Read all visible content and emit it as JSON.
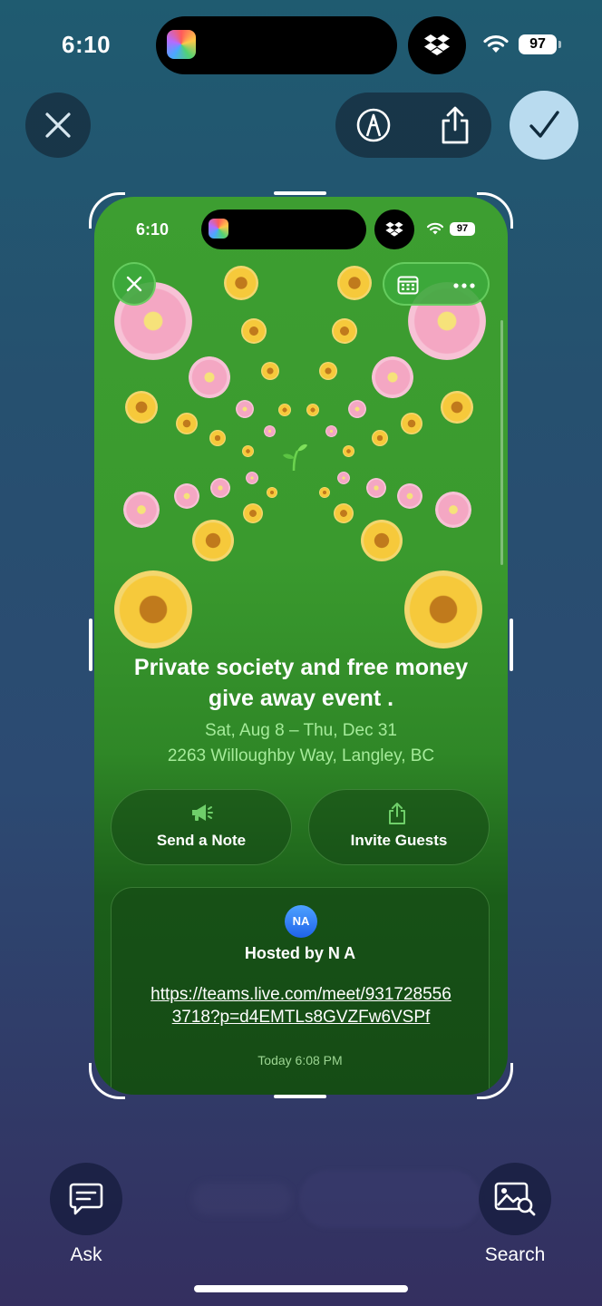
{
  "status_bar": {
    "time": "6:10",
    "battery": "97"
  },
  "top_actions": {
    "close_icon": "close-icon",
    "markup_icon": "markup-pen-icon",
    "share_icon": "share-icon",
    "done_icon": "checkmark-icon"
  },
  "capture": {
    "status_time": "6:10",
    "battery": "97",
    "event": {
      "title": "Private society and free money give away event .",
      "date": "Sat, Aug 8 – Thu, Dec 31",
      "location": "2263 Willoughby Way, Langley, BC"
    },
    "actions": {
      "send_note": "Send a Note",
      "invite_guests": "Invite Guests"
    },
    "host": {
      "initials": "NA",
      "hosted_by": "Hosted by N A",
      "link": "https://teams.live.com/meet/9317285563718?p=d4EMTLs8GVZFw6VSPf",
      "timestamp": "Today 6:08 PM"
    }
  },
  "bottom": {
    "ask_label": "Ask",
    "search_label": "Search"
  },
  "colors": {
    "accent": "#b9dbef",
    "capture_green": "#3d9e31",
    "date_text": "#a5eb9a"
  }
}
